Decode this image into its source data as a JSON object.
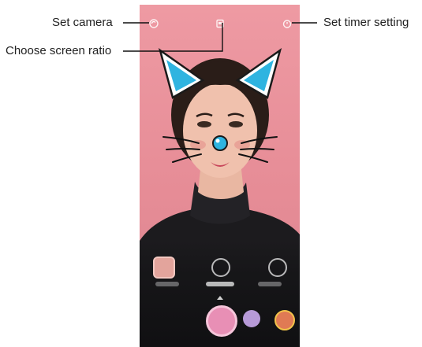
{
  "callouts": {
    "set_camera": "Set camera",
    "choose_screen_ratio": "Choose screen ratio",
    "set_timer_setting": "Set timer setting"
  },
  "colors": {
    "callout_line": "#111111",
    "screen_background": "#e8919a",
    "ear_accent": "#2fb4e0"
  },
  "icons": {
    "set_camera": "camera-switch-icon",
    "screen_ratio": "screen-ratio-icon",
    "timer": "timer-icon",
    "sticker_thumb": "sticker-thumbnail-icon",
    "flip": "flip-icon",
    "rotate": "rotate-camera-icon",
    "shutter": "shutter-button-icon",
    "effect_1": "effect-thumbnail-icon",
    "effect_2": "effect-thumbnail-icon"
  }
}
